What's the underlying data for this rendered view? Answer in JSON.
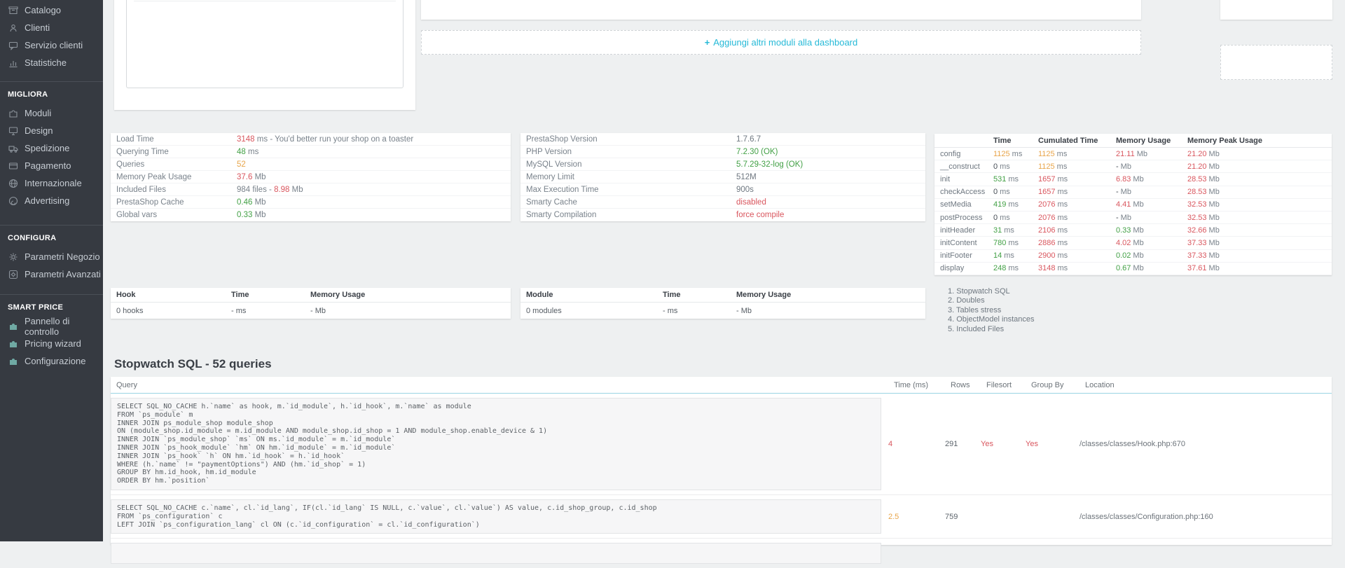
{
  "colors": {
    "red": "#d9565e",
    "green": "#42a045",
    "orange": "#e8a54a",
    "dark": "#474e56",
    "gray": "#6e7780",
    "link": "#25b9d7",
    "sidebar_bg": "#363a41"
  },
  "units": {
    "ms": "ms",
    "mb": "Mb"
  },
  "sidebar": {
    "sections": [
      {
        "items": [
          {
            "icon": "catalog-icon",
            "label": "Catalogo"
          },
          {
            "icon": "customers-icon",
            "label": "Clienti"
          },
          {
            "icon": "customer-service-icon",
            "label": "Servizio clienti"
          },
          {
            "icon": "stats-icon",
            "label": "Statistiche"
          }
        ]
      },
      {
        "header": "MIGLIORA",
        "items": [
          {
            "icon": "modules-icon",
            "label": "Moduli"
          },
          {
            "icon": "design-icon",
            "label": "Design"
          },
          {
            "icon": "shipping-icon",
            "label": "Spedizione"
          },
          {
            "icon": "payment-icon",
            "label": "Pagamento"
          },
          {
            "icon": "international-icon",
            "label": "Internazionale"
          },
          {
            "icon": "advertising-icon",
            "label": "Advertising"
          }
        ]
      },
      {
        "header": "CONFIGURA",
        "items": [
          {
            "icon": "shop-parameters-icon",
            "label": "Parametri Negozio"
          },
          {
            "icon": "advanced-parameters-icon",
            "label": "Parametri Avanzati"
          }
        ]
      },
      {
        "header": "SMART PRICE",
        "items": [
          {
            "icon": "puzzle-icon",
            "label": "Pannello di controllo"
          },
          {
            "icon": "puzzle-icon",
            "label": "Pricing wizard"
          },
          {
            "icon": "puzzle-icon",
            "label": "Configurazione"
          }
        ]
      }
    ]
  },
  "dashboard": {
    "plus": "+",
    "add_modules_label": "Aggiungi altri moduli alla dashboard"
  },
  "perf_left": {
    "rows": [
      {
        "label": "Load Time",
        "prefix": "",
        "num": "3148",
        "num_color": "red",
        "suffix": " ms - You'd better run your shop on a toaster"
      },
      {
        "label": "Querying Time",
        "prefix": "",
        "num": "48",
        "num_color": "green",
        "suffix": " ms"
      },
      {
        "label": "Queries",
        "prefix": "",
        "num": "52",
        "num_color": "orange",
        "suffix": ""
      },
      {
        "label": "Memory Peak Usage",
        "prefix": "",
        "num": "37.6",
        "num_color": "red",
        "suffix": " Mb"
      },
      {
        "label": "Included Files",
        "prefix": "984 files - ",
        "num": "8.98",
        "num_color": "red",
        "suffix": " Mb"
      },
      {
        "label": "PrestaShop Cache",
        "prefix": "",
        "num": "0.46",
        "num_color": "green",
        "suffix": " Mb"
      },
      {
        "label": "Global vars",
        "prefix": "",
        "num": "0.33",
        "num_color": "green",
        "suffix": " Mb"
      }
    ]
  },
  "env": {
    "rows": [
      {
        "label": "PrestaShop Version",
        "value": "1.7.6.7",
        "color": "gray"
      },
      {
        "label": "PHP Version",
        "value": "7.2.30 (OK)",
        "color": "green"
      },
      {
        "label": "MySQL Version",
        "value": "5.7.29-32-log (OK)",
        "color": "green"
      },
      {
        "label": "Memory Limit",
        "value": "512M",
        "color": "gray"
      },
      {
        "label": "Max Execution Time",
        "value": "900s",
        "color": "gray"
      },
      {
        "label": "Smarty Cache",
        "value": "disabled",
        "color": "red"
      },
      {
        "label": "Smarty Compilation",
        "value": "force compile",
        "color": "red"
      }
    ]
  },
  "timing": {
    "headers": [
      "Time",
      "Cumulated Time",
      "Memory Usage",
      "Memory Peak Usage"
    ],
    "rows": [
      {
        "name": "config",
        "time": "1125",
        "tc": "orange",
        "cum": "1125",
        "cc": "orange",
        "mem": "21.11",
        "mc": "red",
        "peak": "21.20",
        "pc": "red"
      },
      {
        "name": "__construct",
        "time": "0",
        "tc": "dark",
        "cum": "1125",
        "cc": "orange",
        "mem": "-",
        "mc": "dark",
        "peak": "21.20",
        "pc": "red"
      },
      {
        "name": "init",
        "time": "531",
        "tc": "green",
        "cum": "1657",
        "cc": "red",
        "mem": "6.83",
        "mc": "red",
        "peak": "28.53",
        "pc": "red"
      },
      {
        "name": "checkAccess",
        "time": "0",
        "tc": "dark",
        "cum": "1657",
        "cc": "red",
        "mem": "-",
        "mc": "dark",
        "peak": "28.53",
        "pc": "red"
      },
      {
        "name": "setMedia",
        "time": "419",
        "tc": "green",
        "cum": "2076",
        "cc": "red",
        "mem": "4.41",
        "mc": "red",
        "peak": "32.53",
        "pc": "red"
      },
      {
        "name": "postProcess",
        "time": "0",
        "tc": "dark",
        "cum": "2076",
        "cc": "red",
        "mem": "-",
        "mc": "dark",
        "peak": "32.53",
        "pc": "red"
      },
      {
        "name": "initHeader",
        "time": "31",
        "tc": "green",
        "cum": "2106",
        "cc": "red",
        "mem": "0.33",
        "mc": "green",
        "peak": "32.66",
        "pc": "red"
      },
      {
        "name": "initContent",
        "time": "780",
        "tc": "green",
        "cum": "2886",
        "cc": "red",
        "mem": "4.02",
        "mc": "red",
        "peak": "37.33",
        "pc": "red"
      },
      {
        "name": "initFooter",
        "time": "14",
        "tc": "green",
        "cum": "2900",
        "cc": "red",
        "mem": "0.02",
        "mc": "green",
        "peak": "37.33",
        "pc": "red"
      },
      {
        "name": "display",
        "time": "248",
        "tc": "green",
        "cum": "3148",
        "cc": "red",
        "mem": "0.67",
        "mc": "green",
        "peak": "37.61",
        "pc": "red"
      }
    ]
  },
  "hooks": {
    "headers": [
      "Hook",
      "Time",
      "Memory Usage"
    ],
    "cells": [
      "0 hooks",
      "- ms",
      "- Mb"
    ]
  },
  "modules": {
    "headers": [
      "Module",
      "Time",
      "Memory Usage"
    ],
    "cells": [
      "0 modules",
      "- ms",
      "- Mb"
    ]
  },
  "profiler_nav": {
    "items": [
      "1. Stopwatch SQL",
      "2. Doubles",
      "3. Tables stress",
      "4. ObjectModel instances",
      "5. Included Files"
    ]
  },
  "sql": {
    "title": "Stopwatch SQL - 52 queries",
    "headers": [
      "Query",
      "Time (ms)",
      "Rows",
      "Filesort",
      "Group By",
      "Location"
    ],
    "queries": [
      {
        "lines": [
          "SELECT SQL_NO_CACHE h.`name` as hook, m.`id_module`, h.`id_hook`, m.`name` as module",
          "FROM `ps_module` m",
          "INNER JOIN ps_module_shop module_shop",
          "ON (module_shop.id_module = m.id_module AND module_shop.id_shop = 1 AND module_shop.enable_device & 1)",
          "INNER JOIN `ps_module_shop` `ms` ON ms.`id_module` = m.`id_module`",
          "INNER JOIN `ps_hook_module` `hm` ON hm.`id_module` = m.`id_module`",
          "INNER JOIN `ps_hook` `h` ON hm.`id_hook` = h.`id_hook`",
          "WHERE (h.`name` != \"paymentOptions\") AND (hm.`id_shop` = 1)",
          "GROUP BY hm.id_hook, hm.id_module",
          "ORDER BY hm.`position`"
        ],
        "time": "4",
        "tc": "red",
        "rows_count": "291",
        "filesort": "Yes",
        "fc": "red",
        "groupby": "Yes",
        "gc": "red",
        "location": "/classes/classes/Hook.php:670"
      },
      {
        "lines": [
          "SELECT SQL_NO_CACHE c.`name`, cl.`id_lang`, IF(cl.`id_lang` IS NULL, c.`value`, cl.`value`) AS value, c.id_shop_group, c.id_shop",
          "FROM `ps_configuration` c",
          "LEFT JOIN `ps_configuration_lang` cl ON (c.`id_configuration` = cl.`id_configuration`)"
        ],
        "time": "2.5",
        "tc": "orange",
        "rows_count": "759",
        "filesort": "",
        "fc": "dark",
        "groupby": "",
        "gc": "dark",
        "location": "/classes/classes/Configuration.php:160"
      }
    ]
  }
}
